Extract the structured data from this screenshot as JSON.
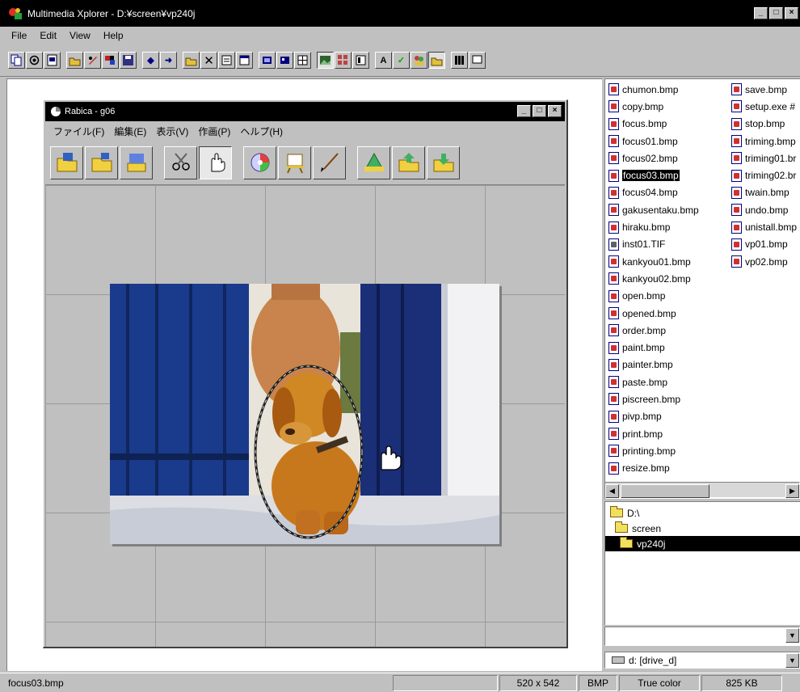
{
  "window": {
    "title": "Multimedia Xplorer - D:¥screen¥vp240j",
    "controls": [
      "_",
      "□",
      "×"
    ]
  },
  "menu": [
    {
      "label": "File",
      "key": "F"
    },
    {
      "label": "Edit",
      "key": "E"
    },
    {
      "label": "View",
      "key": "V"
    },
    {
      "label": "Help",
      "key": "H"
    }
  ],
  "child": {
    "title": "Rabica - g06",
    "menu": [
      "ファイル(F)",
      "編集(E)",
      "表示(V)",
      "作画(P)",
      "ヘルプ(H)"
    ],
    "tools": [
      "open-folder-icon",
      "new-folder-icon",
      "scan-icon",
      "scissors-icon",
      "hand-icon",
      "color-disc-icon",
      "easel-icon",
      "brush-icon",
      "pyramid-icon",
      "export-icon",
      "import-icon"
    ],
    "active_tool": "hand-icon"
  },
  "files_col1": [
    "chumon.bmp",
    "copy.bmp",
    "focus.bmp",
    "focus01.bmp",
    "focus02.bmp",
    "focus03.bmp",
    "focus04.bmp",
    "gakusentaku.bmp",
    "hiraku.bmp",
    "inst01.TIF",
    "kankyou01.bmp",
    "kankyou02.bmp",
    "open.bmp",
    "opened.bmp",
    "order.bmp",
    "paint.bmp",
    "painter.bmp",
    "paste.bmp",
    "piscreen.bmp",
    "pivp.bmp",
    "print.bmp",
    "printing.bmp",
    "resize.bmp"
  ],
  "files_col2": [
    "save.bmp",
    "setup.exe #",
    "stop.bmp",
    "triming.bmp",
    "triming01.br",
    "triming02.br",
    "twain.bmp",
    "undo.bmp",
    "unistall.bmp",
    "vp01.bmp",
    "vp02.bmp"
  ],
  "selected_file": "focus03.bmp",
  "tree": [
    "D:\\",
    "screen",
    "vp240j"
  ],
  "drive": "d: [drive_d]",
  "status": {
    "filename": "focus03.bmp",
    "dimensions": "520 x 542",
    "format": "BMP",
    "color": "True color",
    "size": "825 KB"
  }
}
